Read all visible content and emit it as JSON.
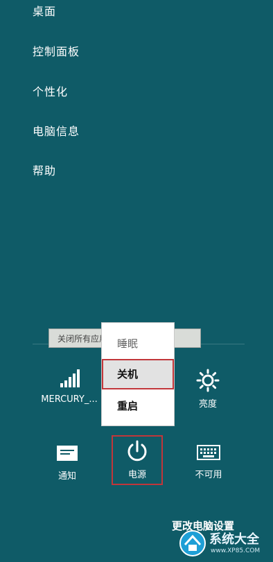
{
  "charms_menu": {
    "items": [
      "桌面",
      "控制面板",
      "个性化",
      "电脑信息",
      "帮助"
    ]
  },
  "tooltip": {
    "text": "关闭所有应用，然后关闭电脑。"
  },
  "power_menu": {
    "sleep_label": "睡眠",
    "shutdown_label": "关机",
    "restart_label": "重启"
  },
  "quick_settings": {
    "network_label": "MERCURY_...",
    "brightness_label": "亮度",
    "notifications_label": "通知",
    "power_label": "电源",
    "keyboard_label": "不可用"
  },
  "footer": {
    "change_pc_settings": "更改电脑设置"
  },
  "watermark": {
    "brand": "系统大全",
    "url": "www.XP85.COM"
  },
  "colors": {
    "background": "#0f5b67",
    "highlight_border": "#c1363a"
  }
}
